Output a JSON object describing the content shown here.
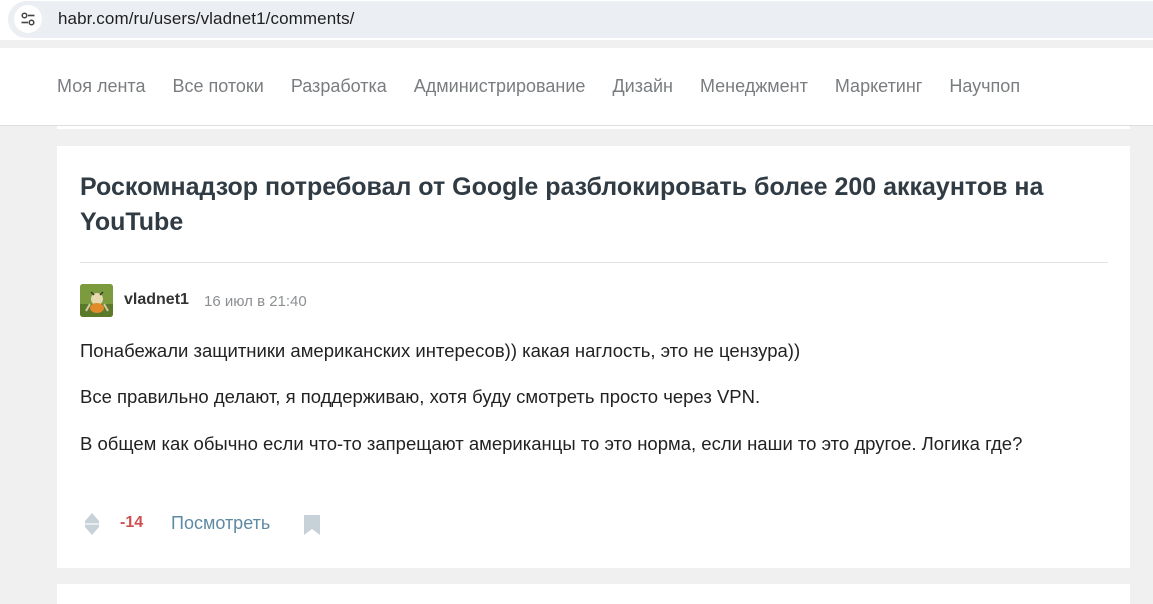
{
  "browser": {
    "url": "habr.com/ru/users/vladnet1/comments/",
    "site_icon": "tune-icon"
  },
  "nav": {
    "items": [
      {
        "label": "Моя лента"
      },
      {
        "label": "Все потоки"
      },
      {
        "label": "Разработка"
      },
      {
        "label": "Администрирование"
      },
      {
        "label": "Дизайн"
      },
      {
        "label": "Менеджмент"
      },
      {
        "label": "Маркетинг"
      },
      {
        "label": "Научпоп"
      }
    ]
  },
  "article": {
    "title": "Роскомнадзор потребовал от Google разблокировать более 200 аккаунтов на YouTube"
  },
  "comment": {
    "author": "vladnet1",
    "timestamp": "16 июл в 21:40",
    "paragraphs": [
      "Понабежали защитники американских интересов)) какая наглость, это не цензура))",
      "Все правильно делают, я поддерживаю, хотя буду смотреть просто через VPN.",
      "В общем как обычно если что-то запрещают американцы то это норма, если наши то это другое. Логика где?"
    ],
    "score": "-14",
    "view_label": "Посмотреть",
    "vote_icon": "vote-diamond-icon",
    "bookmark_icon": "bookmark-icon"
  },
  "colors": {
    "score_negative": "#d04e4e",
    "link": "#5e8aa3",
    "nav_text": "#797d80",
    "page_bg": "#f0f0f0"
  }
}
